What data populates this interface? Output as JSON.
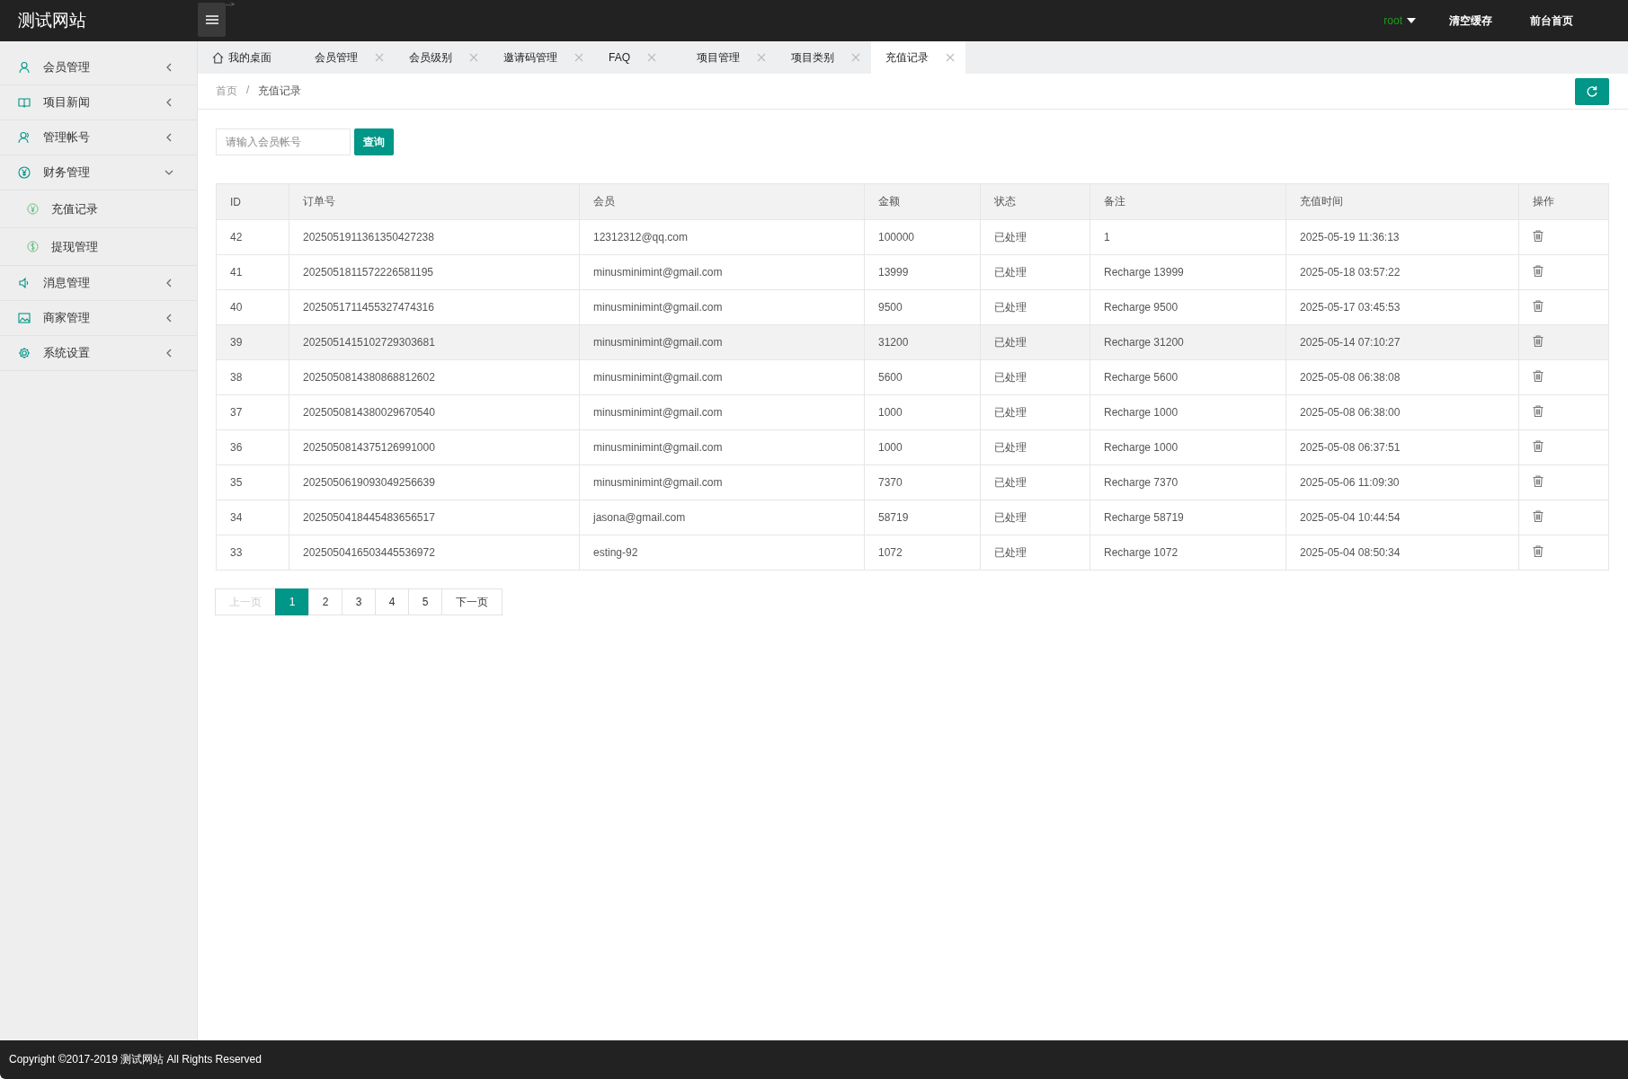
{
  "header": {
    "logo": "测试网站",
    "stray_text": "-->",
    "user": "root",
    "links": [
      "清空缓存",
      "前台首页"
    ]
  },
  "sidebar": {
    "items": [
      {
        "label": "会员管理",
        "expanded": false
      },
      {
        "label": "项目新闻",
        "expanded": false
      },
      {
        "label": "管理帐号",
        "expanded": false
      },
      {
        "label": "财务管理",
        "expanded": true,
        "children": [
          {
            "label": "充值记录"
          },
          {
            "label": "提现管理"
          }
        ]
      },
      {
        "label": "消息管理",
        "expanded": false
      },
      {
        "label": "商家管理",
        "expanded": false
      },
      {
        "label": "系统设置",
        "expanded": false
      }
    ]
  },
  "tabs": [
    {
      "label": "我的桌面",
      "kind": "home",
      "selected": false
    },
    {
      "label": "会员管理",
      "kind": "closable",
      "selected": false
    },
    {
      "label": "会员级别",
      "kind": "closable",
      "selected": false
    },
    {
      "label": "邀请码管理",
      "kind": "closable",
      "selected": false
    },
    {
      "label": "FAQ",
      "kind": "closable",
      "selected": false
    },
    {
      "label": "项目管理",
      "kind": "closable",
      "selected": false
    },
    {
      "label": "项目类别",
      "kind": "closable",
      "selected": false
    },
    {
      "label": "充值记录",
      "kind": "closable",
      "selected": true
    }
  ],
  "breadcrumb": [
    "首页",
    "/",
    "充值记录"
  ],
  "search": {
    "placeholder": "请输入会员帐号",
    "button": "查询"
  },
  "table": {
    "columns": [
      "ID",
      "订单号",
      "会员",
      "金额",
      "状态",
      "备注",
      "充值时间",
      "操作"
    ],
    "rows": [
      {
        "cells": [
          "42",
          "2025051911361350427238",
          "12312312@qq.com",
          "100000",
          "已处理",
          "1",
          "2025-05-19 11:36:13"
        ],
        "hovered": false
      },
      {
        "cells": [
          "41",
          "2025051811572226581195",
          "minusminimint@gmail.com",
          "13999",
          "已处理",
          "Recharge 13999",
          "2025-05-18 03:57:22"
        ],
        "hovered": false
      },
      {
        "cells": [
          "40",
          "2025051711455327474316",
          "minusminimint@gmail.com",
          "9500",
          "已处理",
          "Recharge 9500",
          "2025-05-17 03:45:53"
        ],
        "hovered": false
      },
      {
        "cells": [
          "39",
          "2025051415102729303681",
          "minusminimint@gmail.com",
          "31200",
          "已处理",
          "Recharge 31200",
          "2025-05-14 07:10:27"
        ],
        "hovered": true
      },
      {
        "cells": [
          "38",
          "2025050814380868812602",
          "minusminimint@gmail.com",
          "5600",
          "已处理",
          "Recharge 5600",
          "2025-05-08 06:38:08"
        ],
        "hovered": false
      },
      {
        "cells": [
          "37",
          "2025050814380029670540",
          "minusminimint@gmail.com",
          "1000",
          "已处理",
          "Recharge 1000",
          "2025-05-08 06:38:00"
        ],
        "hovered": false
      },
      {
        "cells": [
          "36",
          "2025050814375126991000",
          "minusminimint@gmail.com",
          "1000",
          "已处理",
          "Recharge 1000",
          "2025-05-08 06:37:51"
        ],
        "hovered": false
      },
      {
        "cells": [
          "35",
          "2025050619093049256639",
          "minusminimint@gmail.com",
          "7370",
          "已处理",
          "Recharge 7370",
          "2025-05-06 11:09:30"
        ],
        "hovered": false
      },
      {
        "cells": [
          "34",
          "2025050418445483656517",
          "jasona@gmail.com",
          "58719",
          "已处理",
          "Recharge 58719",
          "2025-05-04 10:44:54"
        ],
        "hovered": false
      },
      {
        "cells": [
          "33",
          "2025050416503445536972",
          "esting-92",
          "1072",
          "已处理",
          "Recharge 1072",
          "2025-05-04 08:50:34"
        ],
        "hovered": false
      }
    ]
  },
  "pagination": {
    "prev": {
      "label": "上一页",
      "disabled": true
    },
    "pages": [
      {
        "label": "1",
        "selected": true
      },
      {
        "label": "2",
        "selected": false
      },
      {
        "label": "3",
        "selected": false
      },
      {
        "label": "4",
        "selected": false
      },
      {
        "label": "5",
        "selected": false
      }
    ],
    "next": {
      "label": "下一页",
      "disabled": false
    }
  },
  "footer": "Copyright ©2017-2019 测试网站 All Rights Reserved"
}
